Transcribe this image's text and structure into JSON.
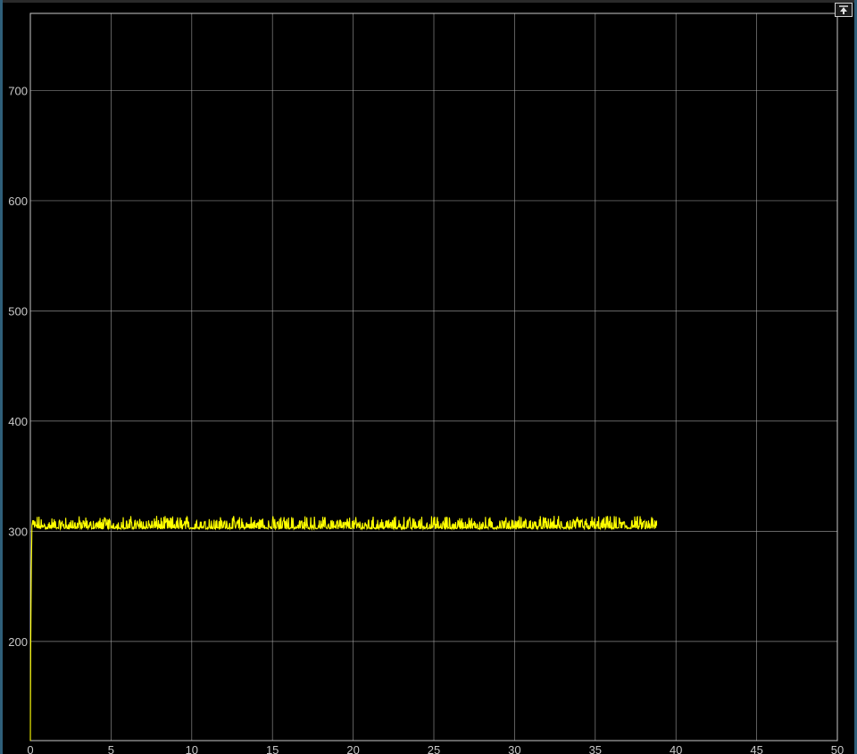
{
  "toolbar": {
    "undock_icon": "undock-arrow-icon"
  },
  "colors": {
    "background": "#000000",
    "grid": "#b4b4b4",
    "axes_box": "#c8c8c8",
    "tick_text": "#c8c8c8",
    "trace": "#ffff00"
  },
  "chart_data": {
    "type": "line",
    "title": "",
    "xlabel": "",
    "ylabel": "",
    "xlim": [
      0,
      50
    ],
    "ylim": [
      110,
      770
    ],
    "grid": true,
    "x_ticks": [
      0,
      5,
      10,
      15,
      20,
      25,
      30,
      35,
      40,
      45,
      50
    ],
    "y_ticks": [
      200,
      300,
      400,
      500,
      600,
      700
    ],
    "series": [
      {
        "color": "#ffff00",
        "startup": {
          "x": [
            0,
            0.02,
            0.06,
            0.1,
            0.15
          ],
          "y": [
            110,
            190,
            265,
            305,
            310
          ]
        },
        "steady_state": {
          "x_start": 0.15,
          "x_end": 38.8,
          "baseline": 302,
          "noise_max": 314,
          "final": 305
        }
      }
    ]
  }
}
